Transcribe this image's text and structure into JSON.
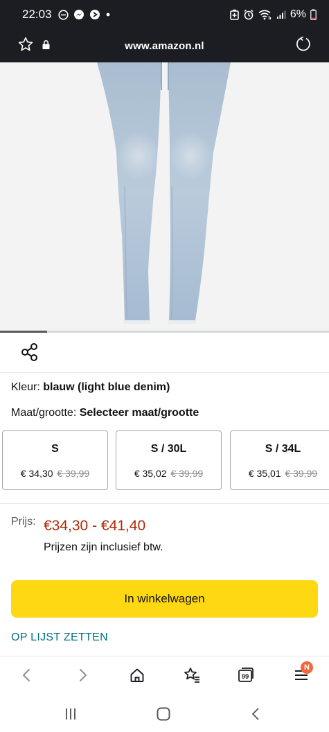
{
  "status_bar": {
    "time": "22:03",
    "battery": "6%"
  },
  "browser": {
    "url": "www.amazon.nl"
  },
  "product": {
    "image_alt": "light blue skinny jeans",
    "image_index": 1,
    "color_label": "Kleur:",
    "color_value": "blauw (light blue denim)",
    "size_label": "Maat/grootte:",
    "size_value": "Selecteer maat/grootte",
    "sizes": [
      {
        "name": "S",
        "price": "€ 34,30",
        "old_price": "€ 39,99"
      },
      {
        "name": "S / 30L",
        "price": "€ 35,02",
        "old_price": "€ 39,99"
      },
      {
        "name": "S / 34L",
        "price": "€ 35,01",
        "old_price": "€ 39,99"
      }
    ],
    "price_label": "Prijs:",
    "price_range": "€34,30 - €41,40",
    "price_note": "Prijzen zijn inclusief btw.",
    "cart_button": "In winkelwagen",
    "wishlist_link": "OP LIJST ZETTEN"
  },
  "bottom_nav": {
    "items": [
      "back-icon",
      "forward-icon",
      "home-icon",
      "favorites-icon",
      "tabs-icon",
      "menu-icon"
    ],
    "tabs_count": "99",
    "menu_badge": "N"
  },
  "colors": {
    "accent_button": "#ffd814",
    "price": "#b12704",
    "link": "#007185",
    "top_bar": "#1b1d22"
  }
}
